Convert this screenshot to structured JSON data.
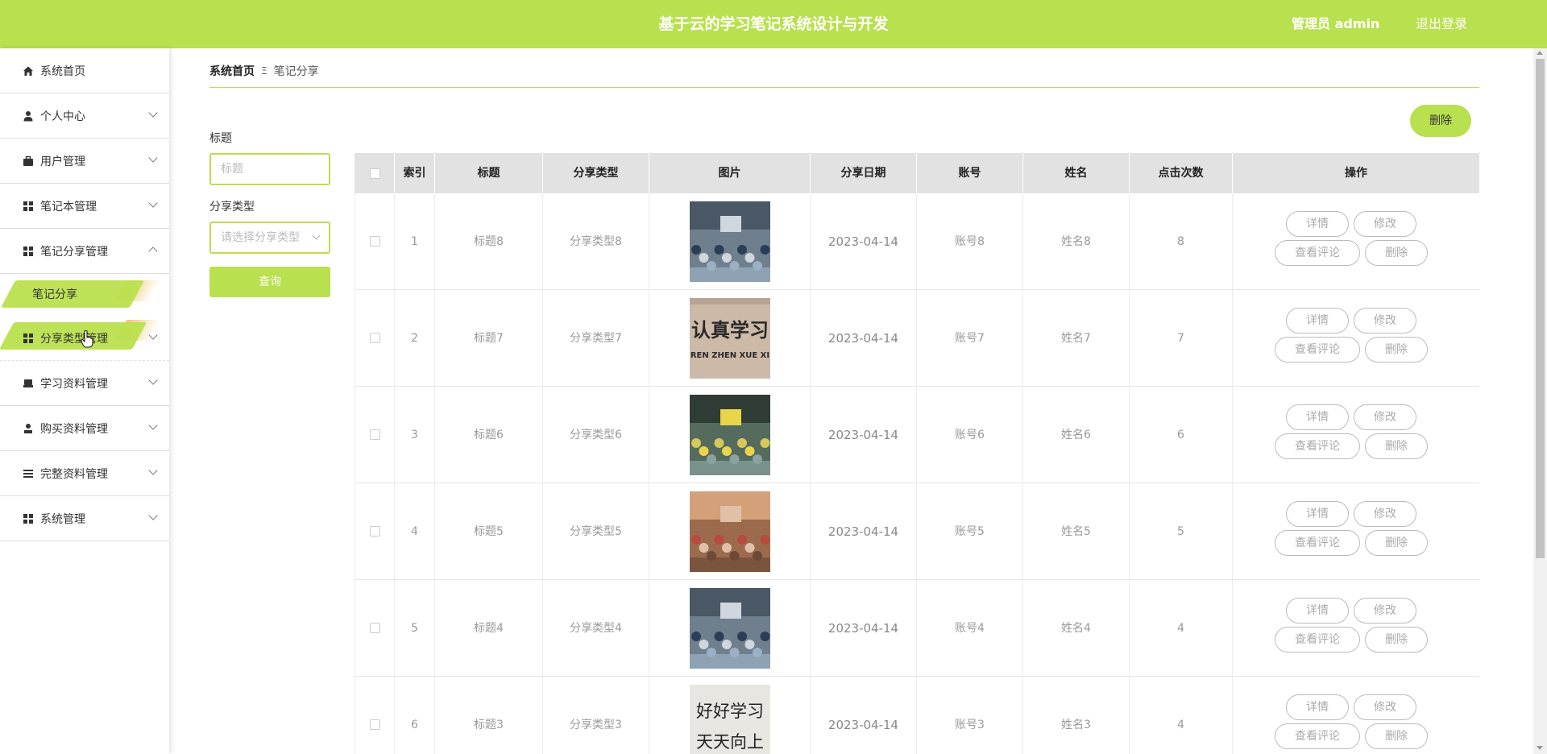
{
  "app": {
    "title": "基于云的学习笔记系统设计与开发",
    "user": "管理员 admin",
    "logout": "退出登录"
  },
  "colors": {
    "accent": "#b9e04e",
    "header_bg": "#e2e2e2"
  },
  "sidebar": {
    "items": [
      {
        "label": "系统首页",
        "icon": "home-icon"
      },
      {
        "label": "个人中心",
        "icon": "user-icon"
      },
      {
        "label": "用户管理",
        "icon": "briefcase-icon"
      },
      {
        "label": "笔记本管理",
        "icon": "grid-icon"
      },
      {
        "label": "笔记分享管理",
        "icon": "grid-icon"
      },
      {
        "label": "笔记分享",
        "icon": ""
      },
      {
        "label": "分享类型管理",
        "icon": "grid-icon"
      },
      {
        "label": "学习资料管理",
        "icon": "printer-icon"
      },
      {
        "label": "购买资料管理",
        "icon": "person-icon"
      },
      {
        "label": "完整资料管理",
        "icon": "list-icon"
      },
      {
        "label": "系统管理",
        "icon": "grid-icon"
      }
    ]
  },
  "breadcrumb": {
    "home": "系统首页",
    "separator": "Ξ",
    "current": "笔记分享"
  },
  "search": {
    "title_label": "标题",
    "title_placeholder": "标题",
    "type_label": "分享类型",
    "type_placeholder": "请选择分享类型",
    "query_button": "查询"
  },
  "toolbar": {
    "delete_label": "删除"
  },
  "table": {
    "columns": [
      "索引",
      "标题",
      "分享类型",
      "图片",
      "分享日期",
      "账号",
      "姓名",
      "点击次数",
      "操作"
    ],
    "actions": {
      "detail": "详情",
      "edit": "修改",
      "comments": "查看评论",
      "delete": "删除"
    },
    "rows": [
      {
        "index": "1",
        "title": "标题8",
        "type": "分享类型8",
        "date": "2023-04-14",
        "account": "账号8",
        "name": "姓名8",
        "clicks": "8",
        "image": "classroom-photo"
      },
      {
        "index": "2",
        "title": "标题7",
        "type": "分享类型7",
        "date": "2023-04-14",
        "account": "账号7",
        "name": "姓名7",
        "clicks": "7",
        "image": "calligraphy-sign",
        "image_text": "认真学习",
        "image_subtext": "REN ZHEN XUE XI"
      },
      {
        "index": "3",
        "title": "标题6",
        "type": "分享类型6",
        "date": "2023-04-14",
        "account": "账号6",
        "name": "姓名6",
        "clicks": "6",
        "image": "classroom-photo"
      },
      {
        "index": "4",
        "title": "标题5",
        "type": "分享类型5",
        "date": "2023-04-14",
        "account": "账号5",
        "name": "姓名5",
        "clicks": "5",
        "image": "classroom-photo"
      },
      {
        "index": "5",
        "title": "标题4",
        "type": "分享类型4",
        "date": "2023-04-14",
        "account": "账号4",
        "name": "姓名4",
        "clicks": "4",
        "image": "classroom-photo"
      },
      {
        "index": "6",
        "title": "标题3",
        "type": "分享类型3",
        "date": "2023-04-14",
        "account": "账号3",
        "name": "姓名3",
        "clicks": "4",
        "image": "handwriting-photo",
        "image_text": "好好学习",
        "image_subtext": "天天向上"
      }
    ]
  }
}
